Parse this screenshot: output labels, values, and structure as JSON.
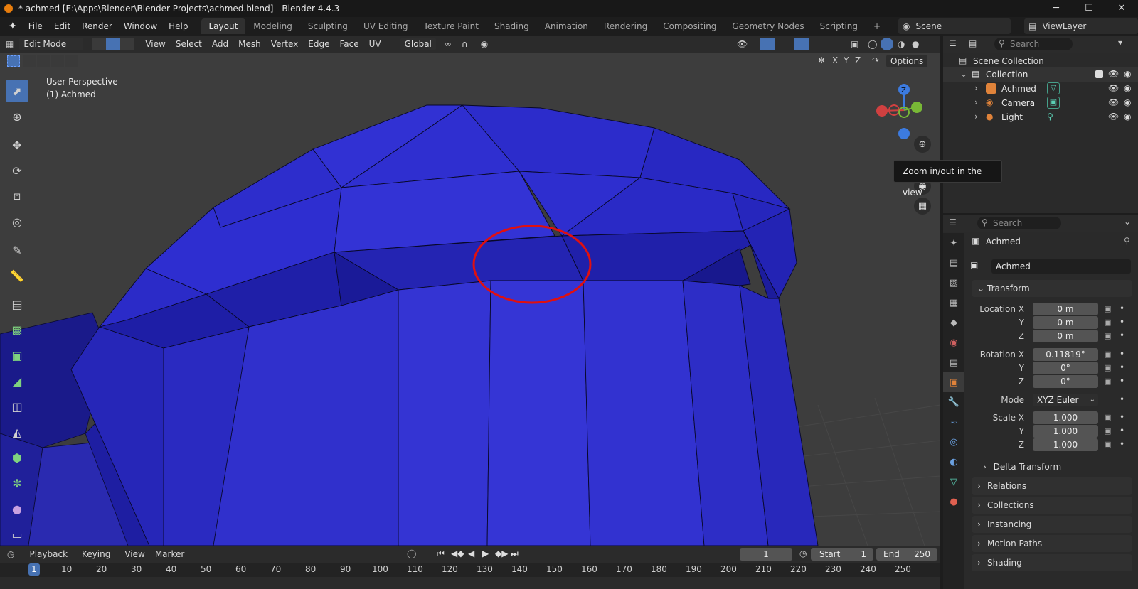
{
  "window": {
    "title": "* achmed [E:\\Apps\\Blender\\Blender Projects\\achmed.blend] - Blender 4.4.3",
    "min": "─",
    "max": "☐",
    "close": "✕"
  },
  "menu": {
    "file": "File",
    "edit": "Edit",
    "render": "Render",
    "window": "Window",
    "help": "Help"
  },
  "workspaces": [
    "Layout",
    "Modeling",
    "Sculpting",
    "UV Editing",
    "Texture Paint",
    "Shading",
    "Animation",
    "Rendering",
    "Compositing",
    "Geometry Nodes",
    "Scripting"
  ],
  "add_tab": "+",
  "scene": {
    "label": "Scene"
  },
  "viewlayer": {
    "label": "ViewLayer"
  },
  "viewport": {
    "mode": "Edit Mode",
    "menus": {
      "view": "View",
      "select": "Select",
      "add": "Add",
      "mesh": "Mesh",
      "vertex": "Vertex",
      "edge": "Edge",
      "face": "Face",
      "uv": "UV"
    },
    "orientation": "Global",
    "axes": {
      "x": "X",
      "y": "Y",
      "z": "Z"
    },
    "options": "Options",
    "perspective": "User Perspective",
    "object": "(1) Achmed",
    "tooltip": "Zoom in/out in the view",
    "gizmo": {
      "z": "Z"
    },
    "colors": {
      "mesh": "#2424c4",
      "highlight": "#e01010"
    }
  },
  "outliner": {
    "search_placeholder": "Search",
    "scene_collection": "Scene Collection",
    "collection": "Collection",
    "items": [
      {
        "name": "Achmed",
        "color": "#e0833a"
      },
      {
        "name": "Camera",
        "color": "#e0833a"
      },
      {
        "name": "Light",
        "color": "#e0833a"
      }
    ]
  },
  "properties": {
    "search_placeholder": "Search",
    "object_name": "Achmed",
    "object_field": "Achmed",
    "transform": "Transform",
    "location": {
      "label": "Location X",
      "x": "0 m",
      "y_label": "Y",
      "y": "0 m",
      "z_label": "Z",
      "z": "0 m"
    },
    "rotation": {
      "label": "Rotation X",
      "x": "0.11819°",
      "y_label": "Y",
      "y": "0°",
      "z_label": "Z",
      "z": "0°"
    },
    "mode": {
      "label": "Mode",
      "value": "XYZ Euler"
    },
    "scale": {
      "label": "Scale X",
      "x": "1.000",
      "y_label": "Y",
      "y": "1.000",
      "z_label": "Z",
      "z": "1.000"
    },
    "delta": "Delta Transform",
    "panels": [
      "Relations",
      "Collections",
      "Instancing",
      "Motion Paths",
      "Shading"
    ]
  },
  "timeline": {
    "playback": "Playback",
    "keying": "Keying",
    "view": "View",
    "marker": "Marker",
    "current": "1",
    "start_label": "Start",
    "start": "1",
    "end_label": "End",
    "end": "250",
    "ticks": [
      "1",
      "10",
      "20",
      "30",
      "40",
      "50",
      "60",
      "70",
      "80",
      "90",
      "100",
      "110",
      "120",
      "130",
      "140",
      "150",
      "160",
      "170",
      "180",
      "190",
      "200",
      "210",
      "220",
      "230",
      "240",
      "250"
    ]
  }
}
